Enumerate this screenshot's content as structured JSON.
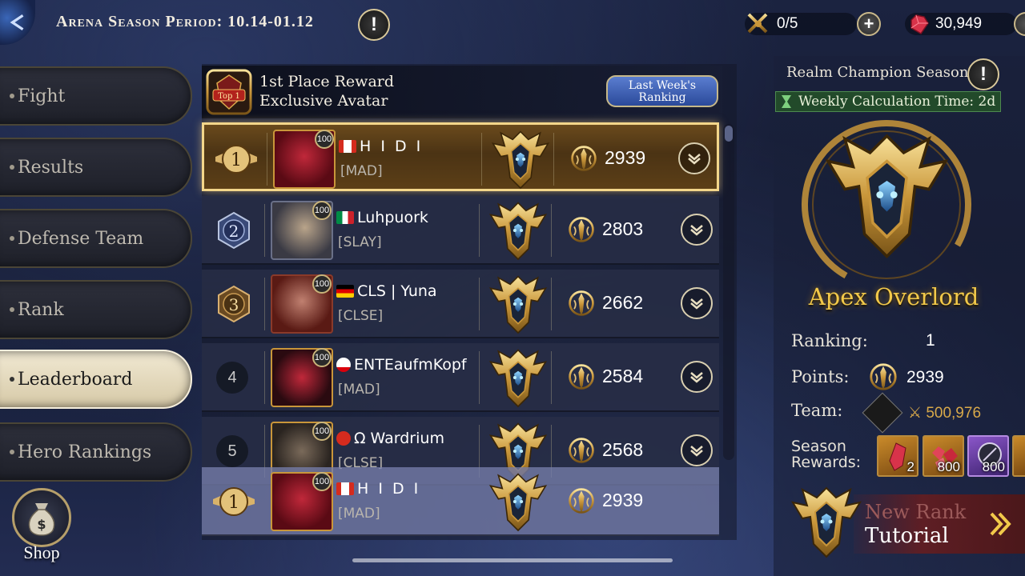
{
  "header": {
    "season_title": "Arena Season Period: 10.14-01.12",
    "info_icon": "exclamation-icon",
    "fight_tickets": "0/5",
    "gems": "30,949",
    "colors": {
      "gold": "#f2c94a",
      "panel": "#28304a",
      "first_row": "#5c3f17"
    }
  },
  "sidebar": {
    "items": [
      {
        "label": "Fight"
      },
      {
        "label": "Results"
      },
      {
        "label": "Defense Team"
      },
      {
        "label": "Rank"
      },
      {
        "label": "Leaderboard",
        "active": true
      },
      {
        "label": "Hero Rankings"
      }
    ],
    "shop_label": "Shop"
  },
  "leaderboard": {
    "reward_badge": "Top 1",
    "reward_line1": "1st Place Reward",
    "reward_line2": "Exclusive Avatar",
    "last_week_button": "Last Week's Ranking",
    "rows": [
      {
        "rank": "1",
        "level": "100",
        "flag": "CA",
        "name": "H I D I",
        "guild": "[MAD]",
        "points": "2939"
      },
      {
        "rank": "2",
        "level": "100",
        "flag": "IT",
        "name": "Luhpuork",
        "guild": "[SLAY]",
        "points": "2803"
      },
      {
        "rank": "3",
        "level": "100",
        "flag": "DE",
        "name": "CLS | Yuna",
        "guild": "[CLSE]",
        "points": "2662"
      },
      {
        "rank": "4",
        "level": "100",
        "flag": "GI",
        "name": "ENTEaufmKopf",
        "guild": "[MAD]",
        "points": "2584"
      },
      {
        "rank": "5",
        "level": "100",
        "flag": "CH",
        "name": "Ω Wardrium",
        "guild": "[CLSE]",
        "points": "2568"
      }
    ],
    "my_row": {
      "rank": "1",
      "level": "100",
      "flag": "CA",
      "name": "H I D I",
      "guild": "[MAD]",
      "points": "2939"
    }
  },
  "season_panel": {
    "title": "Realm Champion Season",
    "weekly_calc": "Weekly Calculation Time: 2d",
    "rank_title": "Apex Overlord",
    "ranking_label": "Ranking:",
    "ranking_value": "1",
    "points_label": "Points:",
    "points_value": "2939",
    "team_label": "Team:",
    "team_power": "500,976",
    "rewards_label_line1": "Season",
    "rewards_label_line2": "Rewards:",
    "rewards": [
      {
        "qty": "2",
        "icon": "gem-shard-icon"
      },
      {
        "qty": "800",
        "icon": "gems-icon"
      },
      {
        "qty": "800",
        "icon": "token-icon"
      },
      {
        "qty": "",
        "icon": "reward-icon"
      }
    ],
    "tutorial_line1": "New Rank",
    "tutorial_line2": "Tutorial"
  }
}
